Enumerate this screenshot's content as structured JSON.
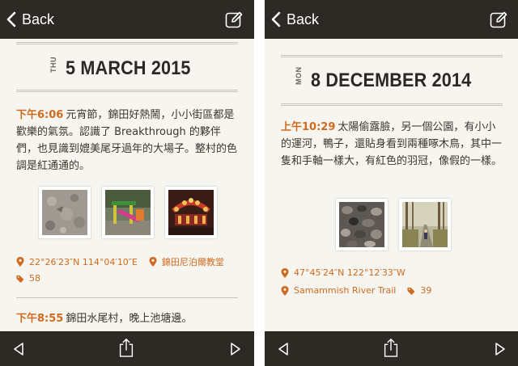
{
  "left": {
    "navbar": {
      "back_label": "Back",
      "edit_icon": "compose-icon"
    },
    "day": {
      "dow": "THU",
      "date": "5 MARCH 2015"
    },
    "entries": [
      {
        "time": "下午6:06",
        "text": "元宵節，錦田好熱鬧，小小街區都是歡樂的氣氛。認識了 Breakthrough 的夥伴們，也見識到媲美尾牙過年的大場子。整村的色調是紅通通的。"
      },
      {
        "time": "下午8:55",
        "text": "錦田水尾村，晚上池塘邊。"
      }
    ],
    "photos": [
      "stone-ground-photo",
      "playground-photo",
      "lantern-night-photo"
    ],
    "meta": {
      "coords": "22°26′23″N 114°04′10″E",
      "place": "錦田尼泊爾教堂",
      "tag_count": "58"
    },
    "toolbar": {
      "prev": "previous-icon",
      "share": "share-icon",
      "next": "next-icon"
    }
  },
  "right": {
    "navbar": {
      "back_label": "Back",
      "edit_icon": "compose-icon"
    },
    "day": {
      "dow": "MON",
      "date": "8 DECEMBER 2014"
    },
    "entries": [
      {
        "time": "上午10:29",
        "text": "太陽偷露臉，另一個公園，有小小的運河，鴨子，還貼身看到兩種啄木鳥，其中一隻和手軸一樣大，有紅色的羽冠，像假的一樣。"
      }
    ],
    "photos": [
      "pebbles-photo",
      "tree-path-photo"
    ],
    "meta": {
      "coords": "47°45′24″N 122°12′33″W",
      "place": "Samammish River Trail",
      "tag_count": "39"
    },
    "toolbar": {
      "prev": "previous-icon",
      "share": "share-icon",
      "next": "next-icon"
    }
  },
  "colors": {
    "accent": "#d06a1f",
    "bar": "#2d2a26",
    "paper": "#f7f5ef",
    "text": "#3a3632"
  }
}
